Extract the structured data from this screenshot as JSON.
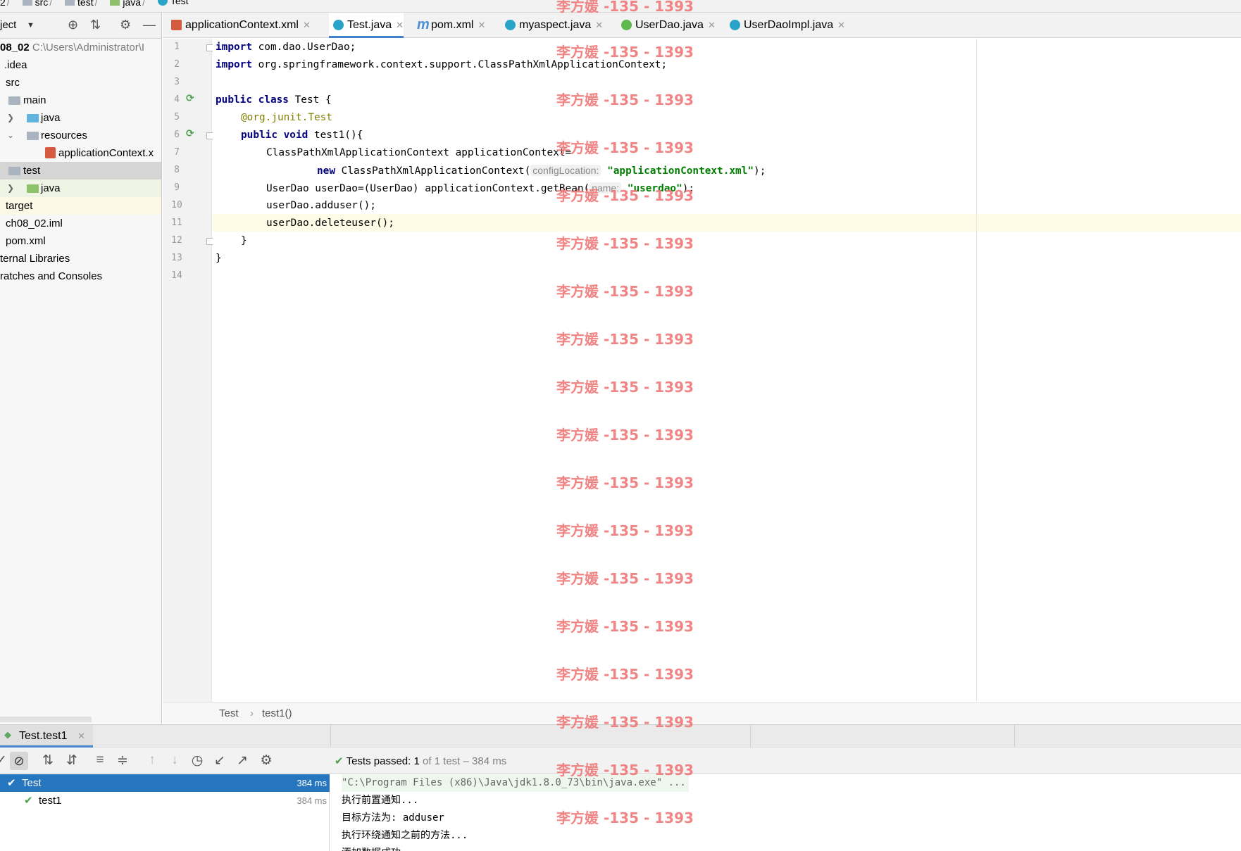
{
  "breadcrumb": [
    "2",
    "src",
    "test",
    "java",
    "Test"
  ],
  "project": {
    "title": "ject",
    "root_name": "08_02",
    "root_path": "C:\\Users\\Administrator\\I",
    "items": [
      {
        "label": ".idea"
      },
      {
        "label": "src"
      },
      {
        "label": "main"
      },
      {
        "label": "java"
      },
      {
        "label": "resources"
      },
      {
        "label": "applicationContext.x"
      },
      {
        "label": "test"
      },
      {
        "label": "java"
      },
      {
        "label": "target"
      },
      {
        "label": "ch08_02.iml"
      },
      {
        "label": "pom.xml"
      },
      {
        "label": "ternal Libraries"
      },
      {
        "label": "ratches and Consoles"
      }
    ]
  },
  "tabs": [
    {
      "label": "applicationContext.xml",
      "icon": "xml-file-icon"
    },
    {
      "label": "Test.java",
      "icon": "class-icon",
      "active": true
    },
    {
      "label": "pom.xml",
      "icon": "maven-icon"
    },
    {
      "label": "myaspect.java",
      "icon": "class-icon"
    },
    {
      "label": "UserDao.java",
      "icon": "interface-icon"
    },
    {
      "label": "UserDaoImpl.java",
      "icon": "class-icon"
    }
  ],
  "editor": {
    "line_numbers": [
      "1",
      "2",
      "3",
      "4",
      "5",
      "6",
      "7",
      "8",
      "9",
      "10",
      "11",
      "12",
      "13",
      "14"
    ],
    "line1_kw": "import",
    "line1_rest": " com.dao.UserDao;",
    "line2_kw": "import",
    "line2_rest": " org.springframework.context.support.ClassPathXmlApplicationContext;",
    "line4_kw": "public class",
    "line4_rest": " Test {",
    "line5_at": "@org.junit.",
    "line5_test": "Test",
    "line6_kw": "public void",
    "line6_rest": " test1(){",
    "line7": "ClassPathXmlApplicationContext applicationContext=",
    "line8_kw": "new",
    "line8_mid": " ClassPathXmlApplicationContext(",
    "line8_hint": "configLocation:",
    "line8_str": "\"applicationContext.xml\"",
    "line8_end": ");",
    "line9_start": "UserDao userDao=(UserDao) applicationContext.getBean(",
    "line9_hint": "name:",
    "line9_str": "\"userdao\"",
    "line9_end": ");",
    "line10": "userDao.adduser();",
    "line11": "userDao.deleteuser();",
    "line12": "}",
    "line13": "}",
    "current_line": "11"
  },
  "editor_breadcrumb": [
    "Test",
    "test1()"
  ],
  "run": {
    "tab_label": "Test.test1",
    "status_prefix": "Tests passed:",
    "status_count": "1",
    "status_suffix": "of 1 test – 384 ms",
    "tree": [
      {
        "label": "Test",
        "time": "384 ms"
      },
      {
        "label": "test1",
        "time": "384 ms"
      }
    ],
    "console": [
      "\"C:\\Program Files (x86)\\Java\\jdk1.8.0_73\\bin\\java.exe\" ...",
      "执行前置通知...",
      "目标方法为: adduser",
      "执行环绕通知之前的方法...",
      "添加数据成功"
    ]
  },
  "watermark": "李方媛 -135 - 1393",
  "colors": {
    "accent": "#4083c9",
    "selection": "#2675bf",
    "keyword": "#000080",
    "string": "#008000",
    "watermark": "#f07a7a",
    "pass": "#4aa04a"
  }
}
